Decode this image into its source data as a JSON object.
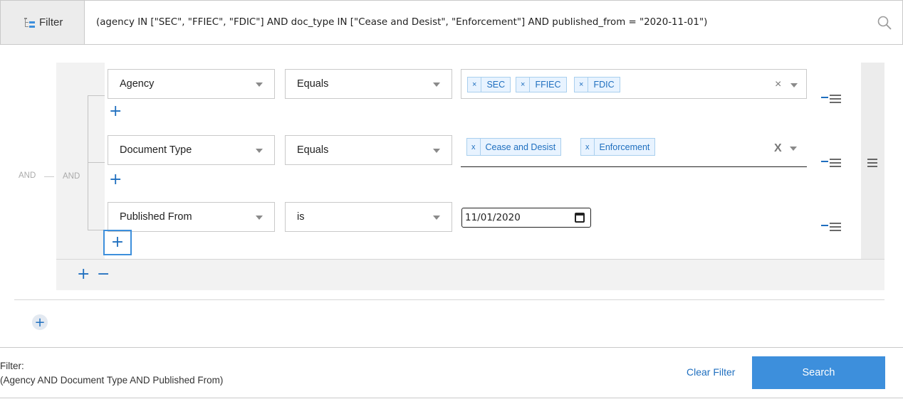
{
  "topbar": {
    "filter_label": "Filter",
    "query": "(agency IN [\"SEC\", \"FFIEC\", \"FDIC\"] AND doc_type IN [\"Cease and Desist\", \"Enforcement\"] AND published_from = \"2020-11-01\")",
    "filter_icon": "filter-tree-icon",
    "search_icon": "search-icon"
  },
  "builder": {
    "outer_conjunction": "AND",
    "inner_conjunction": "AND",
    "rows": [
      {
        "field": "Agency",
        "operator": "Equals",
        "values": [
          "SEC",
          "FFIEC",
          "FDIC"
        ],
        "clear": "×"
      },
      {
        "field": "Document Type",
        "operator": "Equals",
        "values": [
          "Cease and Desist",
          "Enforcement"
        ],
        "clear": "X"
      },
      {
        "field": "Published From",
        "operator": "is",
        "date": "11/01/2020"
      }
    ],
    "tag_remove": "×",
    "tag_remove_alt": "x",
    "add_symbol": "+",
    "remove_symbol": "−"
  },
  "footer": {
    "title": "Filter:",
    "expression": "(Agency AND Document Type AND Published From)",
    "clear_label": "Clear Filter",
    "search_label": "Search"
  },
  "colors": {
    "accent": "#3d8fdc",
    "link": "#1f6fbf",
    "tag_bg": "#e8f3ff",
    "group_bg": "#f2f2f2"
  }
}
